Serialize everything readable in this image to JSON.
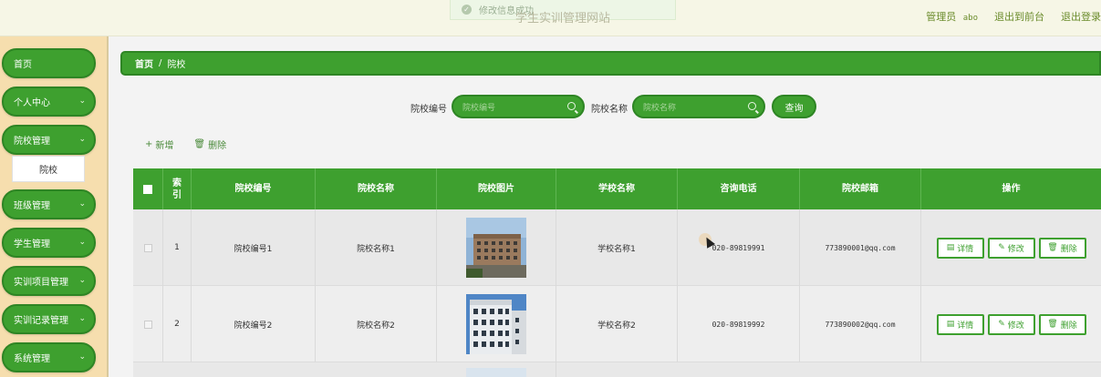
{
  "header": {
    "toast_text": "修改信息成功",
    "site_title": "学生实训管理网站",
    "role_label": "管理员",
    "username": "abo",
    "back_front_label": "退出到前台",
    "logout_label": "退出登录"
  },
  "sidebar": {
    "items": [
      {
        "label": "首页",
        "has_chevron": false
      },
      {
        "label": "个人中心",
        "has_chevron": true
      },
      {
        "label": "院校管理",
        "has_chevron": true
      },
      {
        "label": "班级管理",
        "has_chevron": true
      },
      {
        "label": "学生管理",
        "has_chevron": true
      },
      {
        "label": "实训项目管理",
        "has_chevron": true
      },
      {
        "label": "实训记录管理",
        "has_chevron": true
      },
      {
        "label": "系统管理",
        "has_chevron": true
      }
    ],
    "submenu_label": "院校"
  },
  "breadcrumb": {
    "home": "首页",
    "separator": "/",
    "current": "院校"
  },
  "search": {
    "code_label": "院校编号",
    "code_placeholder": "院校编号",
    "name_label": "院校名称",
    "name_placeholder": "院校名称",
    "button_label": "查询"
  },
  "actions": {
    "add_label": "新增",
    "delete_label": "删除"
  },
  "table": {
    "headers": [
      "索引",
      "院校编号",
      "院校名称",
      "院校图片",
      "学校名称",
      "咨询电话",
      "院校邮箱",
      "操作"
    ],
    "rows": [
      {
        "index": "1",
        "code": "院校编号1",
        "name": "院校名称1",
        "school": "学校名称1",
        "phone": "020-89819991",
        "email": "773890001@qq.com"
      },
      {
        "index": "2",
        "code": "院校编号2",
        "name": "院校名称2",
        "school": "学校名称2",
        "phone": "020-89819992",
        "email": "773890002@qq.com"
      }
    ],
    "op_labels": {
      "detail": "详情",
      "edit": "修改",
      "delete": "删除"
    }
  },
  "colors": {
    "primary_green": "#3ea02f",
    "sidebar_bg": "#f6deae",
    "header_bg": "#f6f6e6"
  }
}
